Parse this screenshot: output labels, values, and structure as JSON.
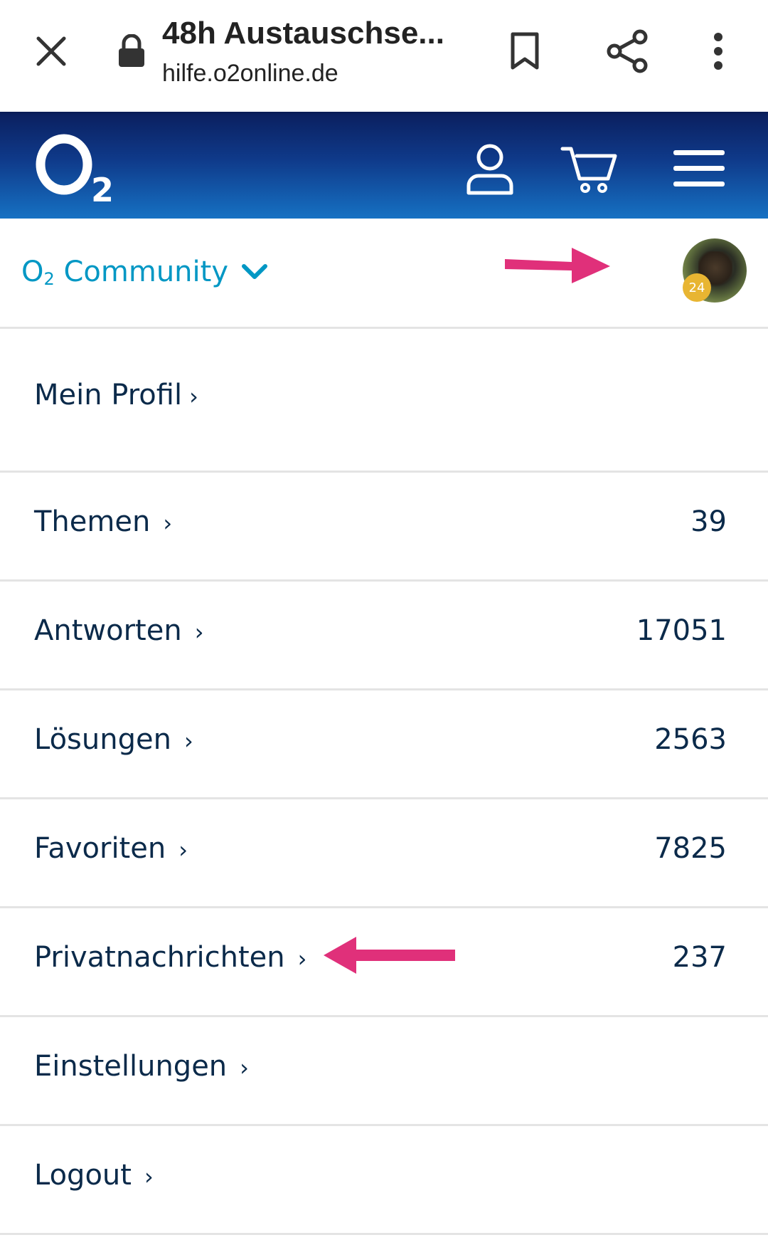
{
  "browser": {
    "title": "48h Austauschse...",
    "url": "hilfe.o2online.de"
  },
  "site": {
    "logo_text": "O",
    "logo_sub": "2"
  },
  "community": {
    "label": "O",
    "label_sub": "2",
    "label_rest": " Community",
    "avatar_badge": "24"
  },
  "menu": {
    "items": [
      {
        "label": "Mein Profil",
        "count": ""
      },
      {
        "label": "Themen",
        "count": "39"
      },
      {
        "label": "Antworten",
        "count": "17051"
      },
      {
        "label": "Lösungen",
        "count": "2563"
      },
      {
        "label": "Favoriten",
        "count": "7825"
      },
      {
        "label": "Privatnachrichten",
        "count": "237"
      },
      {
        "label": "Einstellungen",
        "count": ""
      },
      {
        "label": "Logout",
        "count": ""
      }
    ]
  },
  "colors": {
    "header_top": "#0b1f5e",
    "header_bottom": "#1671c3",
    "community_link": "#0097c4",
    "arrow_annotation": "#e0307a",
    "badge": "#e8b532"
  }
}
